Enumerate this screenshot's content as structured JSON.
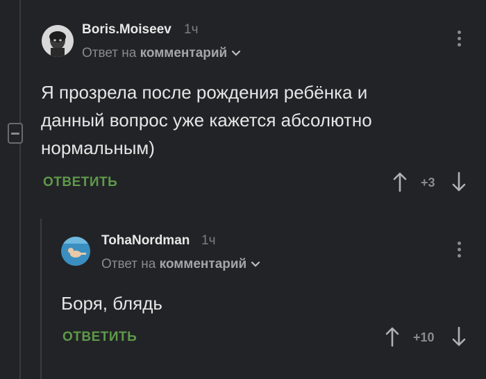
{
  "thread": {
    "comments": [
      {
        "username": "Boris.Moiseev",
        "time": "1ч",
        "reply_prefix": "Ответ на",
        "reply_target": "комментарий",
        "text": "Я прозрела после рождения ребёнка и данный вопрос уже кажется абсолютно нормальным)",
        "reply_label": "ОТВЕТИТЬ",
        "score": "+3",
        "avatar_icon": "user-avatar-photo"
      },
      {
        "username": "TohaNordman",
        "time": "1ч",
        "reply_prefix": "Ответ на",
        "reply_target": "комментарий",
        "text": "Боря, блядь",
        "reply_label": "ОТВЕТИТЬ",
        "score": "+10",
        "avatar_icon": "underwater-baby-photo"
      }
    ]
  },
  "colors": {
    "background": "#222326",
    "accent_reply": "#5e9a4a",
    "thread_line": "#3a3b3f"
  }
}
